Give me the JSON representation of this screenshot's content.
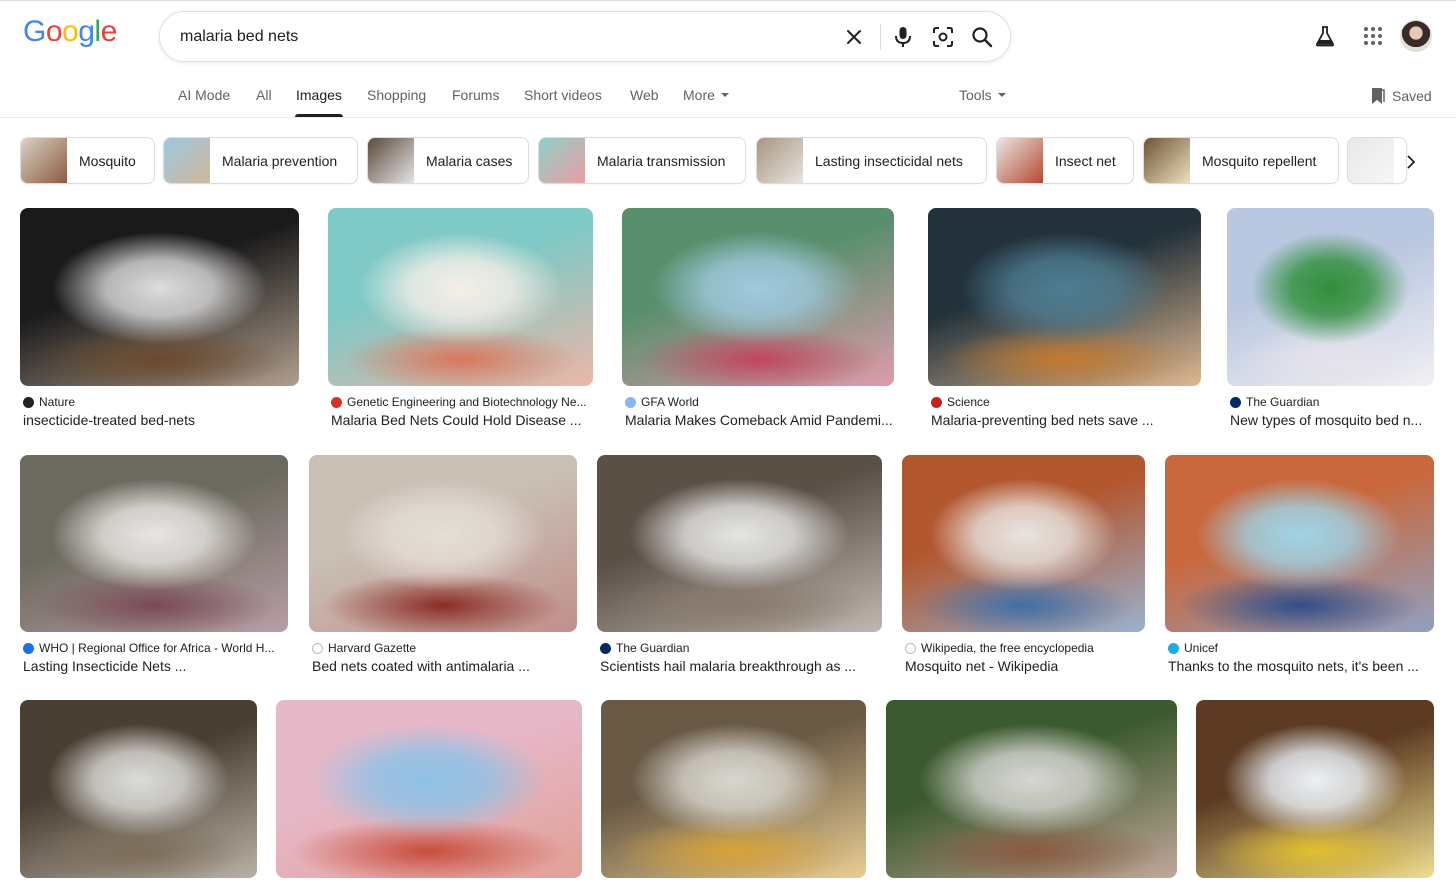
{
  "header": {
    "logo_letters": [
      {
        "ch": "G",
        "color": "#4285F4"
      },
      {
        "ch": "o",
        "color": "#EA4335"
      },
      {
        "ch": "o",
        "color": "#FBBC05"
      },
      {
        "ch": "g",
        "color": "#4285F4"
      },
      {
        "ch": "l",
        "color": "#34A853"
      },
      {
        "ch": "e",
        "color": "#EA4335"
      }
    ],
    "search_value": "malaria bed nets",
    "icons": [
      "close-icon",
      "microphone-icon",
      "lens-icon",
      "search-icon",
      "labs-flask-icon",
      "apps-grid-icon"
    ]
  },
  "tabs": {
    "items": [
      "AI Mode",
      "All",
      "Images",
      "Shopping",
      "Forums",
      "Short videos",
      "Web",
      "More"
    ],
    "active": "Images",
    "tools_label": "Tools",
    "saved_label": "Saved"
  },
  "chips": [
    {
      "label": "Mosquito",
      "colors": [
        "#d9d2c8",
        "#8b5a3c"
      ]
    },
    {
      "label": "Malaria prevention",
      "colors": [
        "#9cc8e0",
        "#d1b79a"
      ]
    },
    {
      "label": "Malaria cases",
      "colors": [
        "#5b4a3a",
        "#e6e6e6"
      ]
    },
    {
      "label": "Malaria transmission",
      "colors": [
        "#8fd0cc",
        "#e89f9f"
      ]
    },
    {
      "label": "Lasting insecticidal nets",
      "colors": [
        "#a89680",
        "#e8e4df"
      ]
    },
    {
      "label": "Insect net",
      "colors": [
        "#e9e7e4",
        "#b4462e"
      ]
    },
    {
      "label": "Mosquito repellent",
      "colors": [
        "#6e5532",
        "#efe0c0"
      ]
    },
    {
      "label": "",
      "colors": [
        "#e8e8e8",
        "#f6f6f6"
      ]
    }
  ],
  "results": [
    {
      "source": "Nature",
      "title": "insecticide-treated bed-nets",
      "fav_color": "#202124",
      "colors": [
        "#1a1a1a",
        "#dcdcdc",
        "#6b4a2b"
      ]
    },
    {
      "source": "Genetic Engineering and Biotechnology Ne...",
      "title": "Malaria Bed Nets Could Hold Disease ...",
      "fav_color": "#d93025",
      "colors": [
        "#7fc9c6",
        "#f4efe8",
        "#d9775b"
      ]
    },
    {
      "source": "GFA World",
      "title": "Malaria Makes Comeback Amid Pandemi...",
      "fav_color": "#8ab4f8",
      "colors": [
        "#5a8f6e",
        "#9fc9de",
        "#c2455f"
      ]
    },
    {
      "source": "Science",
      "title": "Malaria-preventing bed nets save ...",
      "fav_color": "#c5221f",
      "colors": [
        "#22313a",
        "#4f7d92",
        "#c27a2f"
      ]
    },
    {
      "source": "The Guardian",
      "title": "New types of mosquito bed n...",
      "fav_color": "#052962",
      "colors": [
        "#b9c7e0",
        "#2f8f3a",
        "#e7e3ea"
      ]
    },
    {
      "source": "WHO | Regional Office for Africa - World H...",
      "title": "Lasting Insecticide Nets ...",
      "fav_color": "#1a73e8",
      "colors": [
        "#6c6a5f",
        "#e8e6e2",
        "#7a4a55"
      ]
    },
    {
      "source": "Harvard Gazette",
      "title": "Bed nets coated with antimalaria ...",
      "fav_color": "#ffffff",
      "colors": [
        "#c9bfb4",
        "#e5ded6",
        "#8a2d25"
      ]
    },
    {
      "source": "The Guardian",
      "title": "Scientists hail malaria breakthrough as ...",
      "fav_color": "#052962",
      "colors": [
        "#5b5046",
        "#e5e5e3",
        "#8a7a6c"
      ]
    },
    {
      "source": "Wikipedia, the free encyclopedia",
      "title": "Mosquito net - Wikipedia",
      "fav_color": "#ffffff",
      "colors": [
        "#b3572f",
        "#e8e4e0",
        "#3f6fa6"
      ]
    },
    {
      "source": "Unicef",
      "title": "Thanks to the mosquito nets, it's been ...",
      "fav_color": "#1cabe2",
      "colors": [
        "#c9683c",
        "#9fd3e6",
        "#2f4f8a"
      ]
    },
    {
      "source": "",
      "title": "",
      "fav_color": "#ffffff",
      "colors": [
        "#4a3f33",
        "#dcdcd8",
        "#7d6d58"
      ]
    },
    {
      "source": "",
      "title": "",
      "fav_color": "#ffffff",
      "colors": [
        "#e6b8c8",
        "#8fc2e6",
        "#c84d3b"
      ]
    },
    {
      "source": "",
      "title": "",
      "fav_color": "#ffffff",
      "colors": [
        "#6a5a45",
        "#d8d6cf",
        "#d6a236"
      ]
    },
    {
      "source": "",
      "title": "",
      "fav_color": "#ffffff",
      "colors": [
        "#3c5a2f",
        "#d6d6d2",
        "#8a5a40"
      ]
    },
    {
      "source": "",
      "title": "",
      "fav_color": "#ffffff",
      "colors": [
        "#5c3b22",
        "#eaf0f6",
        "#e1c02e"
      ]
    }
  ]
}
